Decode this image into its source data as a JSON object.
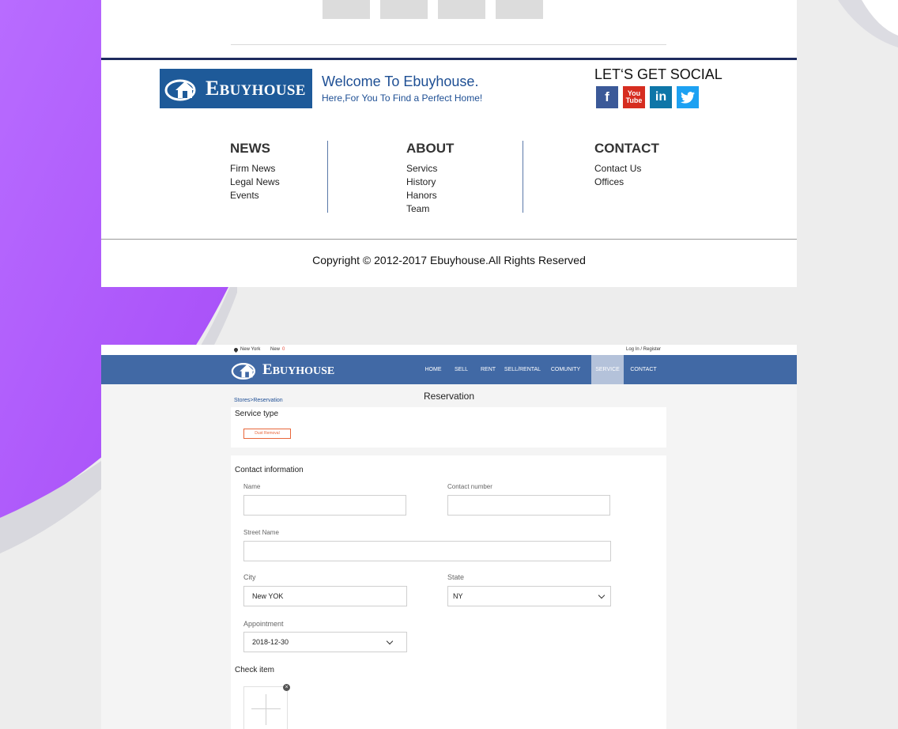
{
  "footer": {
    "brand": {
      "initial": "E",
      "rest": "BUYHOUSE"
    },
    "welcome": "Welcome To Ebuyhouse.",
    "welcome_sub": "Here,For You To Find a Perfect Home!",
    "social_title": "LET‘S GET SOCIAL",
    "social": [
      {
        "icon": "facebook-icon",
        "glyph": "f"
      },
      {
        "icon": "youtube-icon",
        "glyph": "You\nTube"
      },
      {
        "icon": "linkedin-icon",
        "glyph": "in"
      },
      {
        "icon": "twitter-icon",
        "glyph": "🐦"
      }
    ],
    "columns": [
      {
        "title": "NEWS",
        "links": [
          "Firm News",
          "Legal News",
          "Events"
        ]
      },
      {
        "title": "ABOUT",
        "links": [
          "Servics",
          "History",
          "Hanors",
          "Team"
        ]
      },
      {
        "title": "CONTACT",
        "links": [
          "Contact Us",
          "Offices"
        ]
      }
    ],
    "copyright": "Copyright  ©  2012-2017 Ebuyhouse.All Rights Reserved"
  },
  "site": {
    "topbar": {
      "location": "New York",
      "new_label": "New",
      "new_count": "0",
      "login": "Log In / Register"
    },
    "brand": {
      "initial": "E",
      "rest": "BUYHOUSE"
    },
    "nav": [
      "HOME",
      "SELL",
      "RENT",
      "SELL/RENTAL",
      "COMUNITY",
      "SERVICE",
      "CONTACT"
    ],
    "active_nav": "SERVICE",
    "page_title": "Reservation",
    "breadcrumb": "Stores>Reservation",
    "service_type": {
      "title": "Service type",
      "selected": "Dust Removal"
    },
    "contact": {
      "title": "Contact information",
      "name_label": "Name",
      "name_value": "",
      "phone_label": "Contact number",
      "phone_value": "",
      "street_label": "Street Name",
      "street_value": "",
      "city_label": "City",
      "city_value": "New YOK",
      "state_label": "State",
      "state_value": "NY",
      "appointment_label": "Appointment",
      "appointment_value": "2018-12-30",
      "check_label": "Check item"
    }
  },
  "colors": {
    "navy": "#1e2b5e",
    "brand_blue": "#1e5a99",
    "nav_blue": "#4169a5",
    "accent_orange": "#e8663a",
    "purple": "#b05cff"
  }
}
